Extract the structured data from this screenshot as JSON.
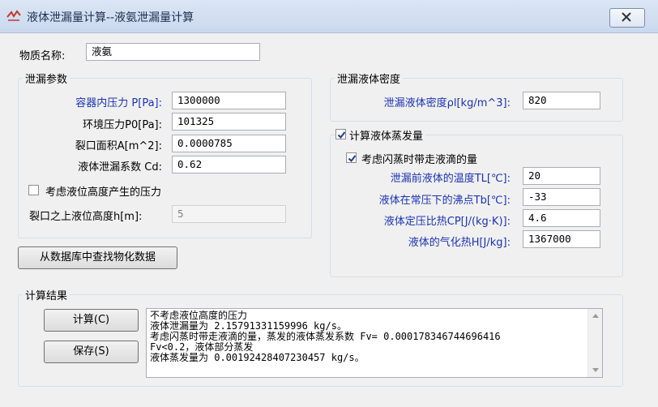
{
  "window": {
    "title": "液体泄漏量计算--液氨泄漏量计算",
    "close_label": "✕"
  },
  "substance": {
    "label": "物质名称:",
    "value": "液氨"
  },
  "leak_params": {
    "title": "泄漏参数",
    "pressure_label": "容器内压力 P[Pa]:",
    "pressure_value": "1300000",
    "ambient_label": "环境压力P0[Pa]:",
    "ambient_value": "101325",
    "area_label": "裂口面积A[m^2]:",
    "area_value": "0.0000785",
    "coef_label": "液体泄漏系数  Cd:",
    "coef_value": "0.62",
    "height_check_label": "考虑液位高度产生的压力",
    "height_label": "裂口之上液位高度h[m]:",
    "height_value": "5"
  },
  "density": {
    "title": "泄漏液体密度",
    "label": "泄漏液体密度ρl[kg/m^3]:",
    "value": "820"
  },
  "evap": {
    "title": "计算液体蒸发量",
    "flash_label": "考虑闪蒸时带走液滴的量",
    "temp_label": "泄漏前液体的温度TL[℃]:",
    "temp_value": "20",
    "boil_label": "液体在常压下的沸点Tb[℃]:",
    "boil_value": "-33",
    "cp_label": "液体定压比热CP[J/(kg·K)]:",
    "cp_value": "4.6",
    "heat_label": "液体的气化热H[J/kg]:",
    "heat_value": "1367000"
  },
  "db_button": "从数据库中查找物化数据",
  "results": {
    "title": "计算结果",
    "calc_button": "计算(C)",
    "save_button": "保存(S)",
    "lines": [
      "不考虑液位高度的压力",
      "液体泄漏量为 2.15791331159996 kg/s。",
      "考虑闪蒸时带走液滴的量，蒸发的液体蒸发系数 Fv= 0.000178346744696416",
      "Fv<0.2，液体部分蒸发",
      "液体蒸发量为 0.00192428407230457 kg/s。"
    ]
  },
  "colors": {
    "label_blue": "#1a33b0",
    "titlebar": "#c9d9ee"
  }
}
